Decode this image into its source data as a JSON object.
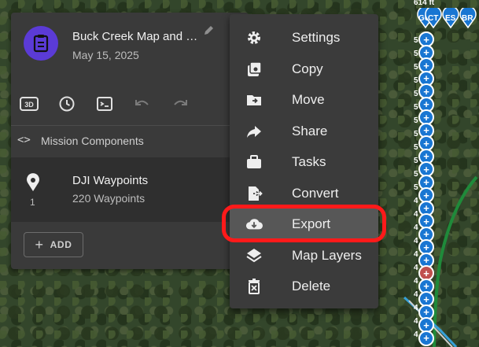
{
  "mission": {
    "title": "Buck Creek Map and …",
    "date": "May 15, 2025",
    "components_label": "Mission Components",
    "component": {
      "name": "DJI Waypoints",
      "subtitle": "220 Waypoints",
      "count": "1"
    },
    "add_label": "ADD",
    "toolbar_icons": [
      "3d-icon",
      "history-icon",
      "terminal-icon",
      "undo-icon",
      "redo-icon"
    ]
  },
  "menu": {
    "items": [
      {
        "label": "Settings",
        "icon": "gear-icon"
      },
      {
        "label": "Copy",
        "icon": "save-icon"
      },
      {
        "label": "Move",
        "icon": "folder-move-icon"
      },
      {
        "label": "Share",
        "icon": "share-arrow-icon"
      },
      {
        "label": "Tasks",
        "icon": "briefcase-icon"
      },
      {
        "label": "Convert",
        "icon": "file-convert-icon"
      },
      {
        "label": "Export",
        "icon": "cloud-download-icon"
      },
      {
        "label": "Map Layers",
        "icon": "layers-icon"
      },
      {
        "label": "Delete",
        "icon": "trash-icon"
      }
    ],
    "active": "Export"
  },
  "map": {
    "top_altitude": "614 ft",
    "pin_labels": [
      "GU",
      "CT",
      "ES",
      "BR"
    ],
    "altitude_labels": [
      "5",
      "5",
      "5",
      "5",
      "5",
      "5",
      "5",
      "5",
      "5",
      "5",
      "5",
      "5",
      "4",
      "4",
      "4",
      "4",
      "4",
      "4",
      "4",
      "4",
      "4",
      "4",
      "4"
    ]
  },
  "colors": {
    "avatar": "#5b3bd6",
    "waypoint_blue": "#1976d2",
    "highlight": "#ff1a1a"
  }
}
